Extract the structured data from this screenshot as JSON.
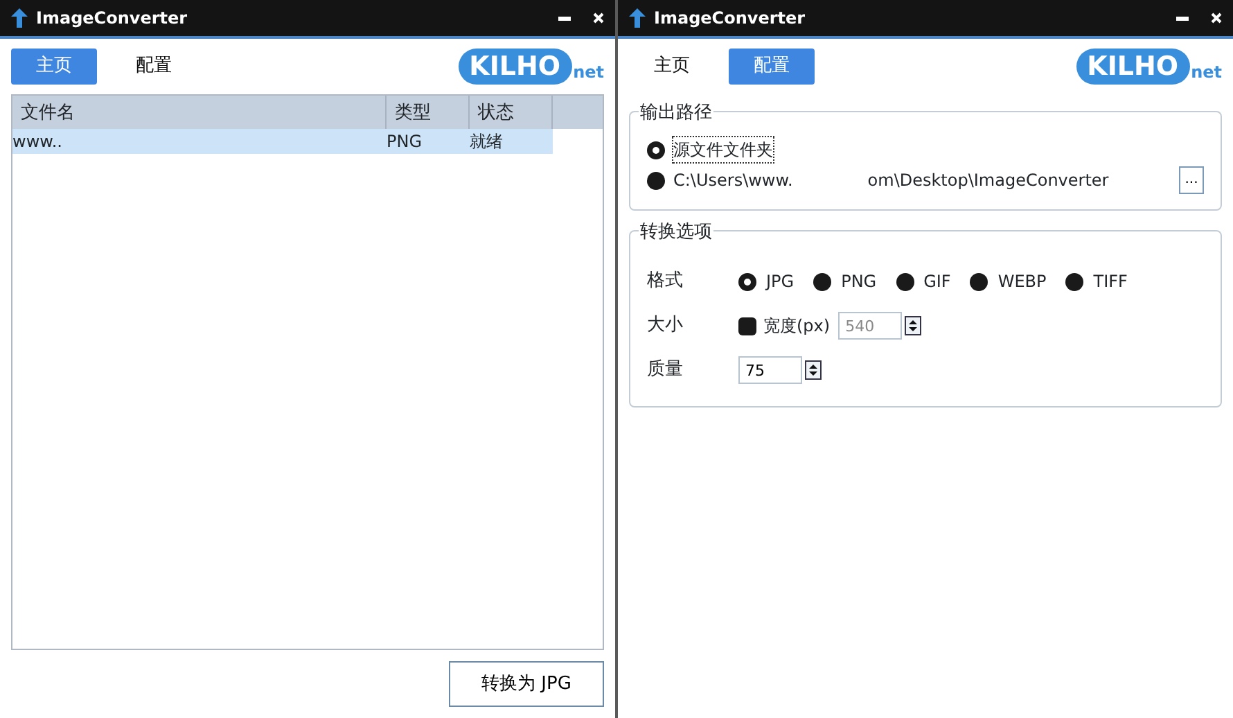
{
  "windows": [
    {
      "kind": "home",
      "title": "ImageConverter",
      "logo": {
        "text": "KILHO",
        "suffix": "net"
      },
      "tabs": [
        {
          "label": "主页",
          "selected": true
        },
        {
          "label": "配置",
          "selected": false
        }
      ],
      "table": {
        "columns": [
          "文件名",
          "类型",
          "状态"
        ],
        "rows": [
          {
            "cells": [
              "www..",
              "PNG",
              "就绪"
            ],
            "selected": true
          }
        ]
      },
      "convert_button": "转换为 JPG"
    },
    {
      "kind": "settings",
      "title": "ImageConverter",
      "logo": {
        "text": "KILHO",
        "suffix": "net"
      },
      "tabs": [
        {
          "label": "主页",
          "selected": false
        },
        {
          "label": "配置",
          "selected": true
        }
      ],
      "output_group": {
        "title": "输出路径",
        "options": [
          {
            "label": "源文件文件夹",
            "selected": true,
            "focused": true
          },
          {
            "label": "C:\\Users\\www.",
            "label_end": "om\\Desktop\\ImageConverter",
            "selected": false,
            "focused": false
          }
        ],
        "browse_button": "..."
      },
      "options_group": {
        "title": "转换选项",
        "format": {
          "label": "格式",
          "choices": [
            {
              "label": "JPG",
              "selected": true
            },
            {
              "label": "PNG",
              "selected": false
            },
            {
              "label": "GIF",
              "selected": false
            },
            {
              "label": "WEBP",
              "selected": false
            },
            {
              "label": "TIFF",
              "selected": false
            }
          ]
        },
        "size": {
          "label": "大小",
          "checkbox": {
            "label": "宽度(px)",
            "checked": false
          },
          "value": "540"
        },
        "quality": {
          "label": "质量",
          "value": "75"
        }
      }
    }
  ]
}
